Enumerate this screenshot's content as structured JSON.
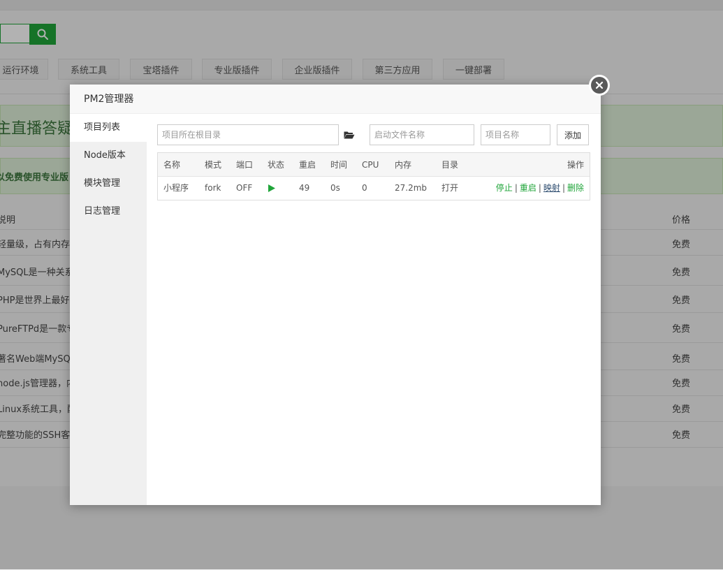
{
  "background": {
    "tabs": [
      "运行环境",
      "系统工具",
      "宝塔插件",
      "专业版插件",
      "企业版插件",
      "第三方应用",
      "一键部署"
    ],
    "banner_text": "主直播答疑",
    "notice_text": "以免费使用专业版",
    "table_header": {
      "desc": "说明",
      "price": "价格"
    },
    "rows": [
      {
        "desc": "轻量级，占有内存少",
        "price": "免费"
      },
      {
        "desc": "MySQL是一种关系数",
        "price": "免费"
      },
      {
        "desc": "PHP是世界上最好的",
        "price": "免费"
      },
      {
        "desc": "PureFTPd是一款专",
        "price": "免费"
      },
      {
        "desc": "著名Web端MySQL",
        "price": "免费"
      },
      {
        "desc": "node.js管理器，内",
        "price": "免费"
      },
      {
        "desc": "Linux系统工具，配",
        "price": "免费"
      },
      {
        "desc": "完整功能的SSH客户",
        "price": "免费"
      }
    ]
  },
  "modal": {
    "title": "PM2管理器",
    "sidebar": [
      "项目列表",
      "Node版本",
      "模块管理",
      "日志管理"
    ],
    "toolbar": {
      "root_dir_placeholder": "项目所在根目录",
      "start_file_placeholder": "启动文件名称",
      "project_name_placeholder": "项目名称",
      "add_label": "添加"
    },
    "table": {
      "headers": [
        "名称",
        "模式",
        "端口",
        "状态",
        "重启",
        "时间",
        "CPU",
        "内存",
        "目录",
        "操作"
      ],
      "rows": [
        {
          "name": "小程序",
          "mode": "fork",
          "port": "OFF",
          "status": "running",
          "restarts": "49",
          "time": "0s",
          "cpu": "0",
          "memory": "27.2mb",
          "dir_action": "打开",
          "actions": [
            "停止",
            "重启",
            "映射",
            "删除"
          ]
        }
      ]
    }
  },
  "colors": {
    "accent": "#20a53a",
    "overlay": "rgba(0,0,0,0.3)"
  },
  "icons": {
    "search": "search-icon",
    "close": "close-icon",
    "folder": "folder-open-icon",
    "status": "play-icon"
  }
}
